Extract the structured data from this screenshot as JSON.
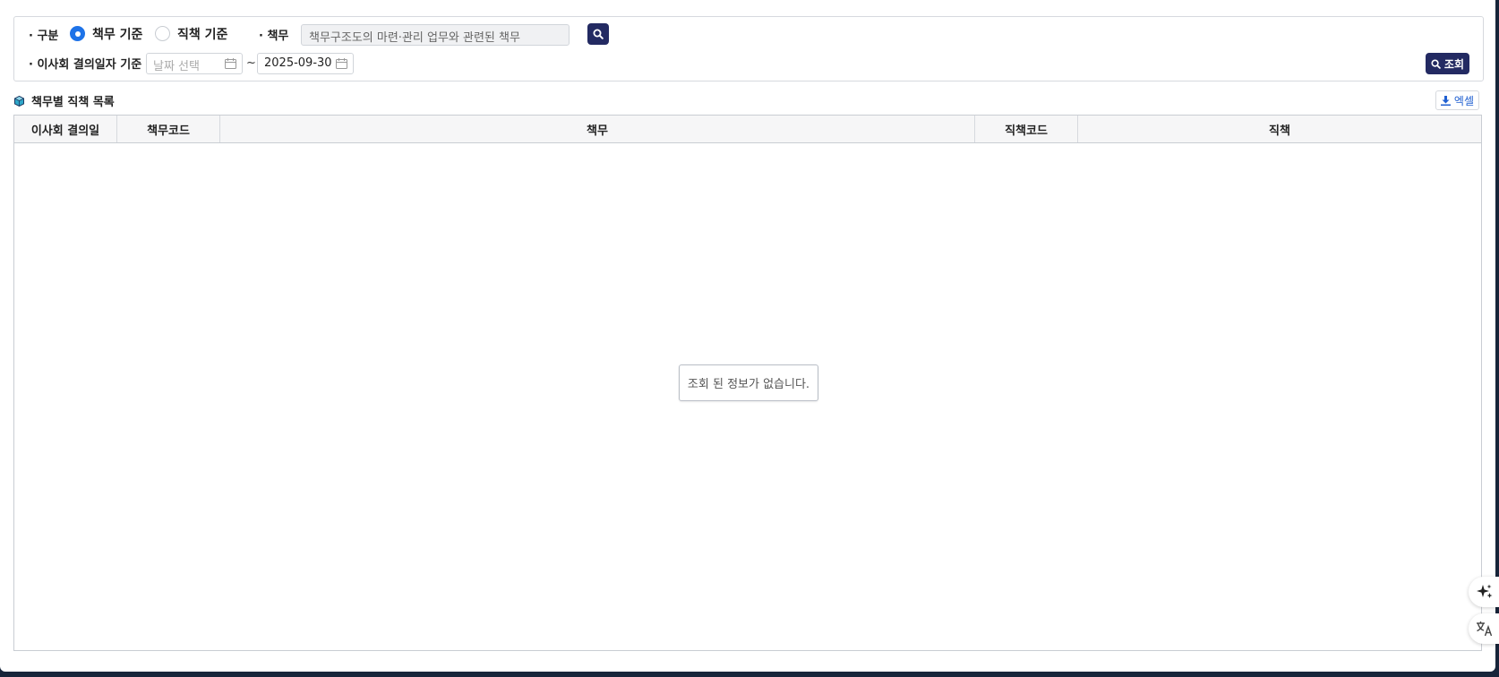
{
  "search": {
    "type_label": "· 구분",
    "type_options": [
      {
        "label": "책무 기준",
        "checked": true
      },
      {
        "label": "직책 기준",
        "checked": false
      }
    ],
    "duty_label": "· 책무",
    "duty_value": "책무구조도의 마련·관리 업무와 관련된 책무",
    "date_label": "· 이사회 결의일자 기준",
    "date_from_placeholder": "날짜 선택",
    "date_separator": "~",
    "date_to_value": "2025-09-30",
    "query_button_label": "조회"
  },
  "section": {
    "title": "책무별 직책 목록",
    "excel_button_label": "엑셀"
  },
  "grid": {
    "columns": [
      "이사회 결의일",
      "책무코드",
      "책무",
      "직책코드",
      "직책"
    ],
    "rows": [],
    "empty_message": "조회 된 정보가 없습니다."
  },
  "colors": {
    "primary_navy": "#232a62",
    "radio_blue": "#1e73e8",
    "excel_blue": "#1f5fd1",
    "window_frame": "#17253a"
  }
}
